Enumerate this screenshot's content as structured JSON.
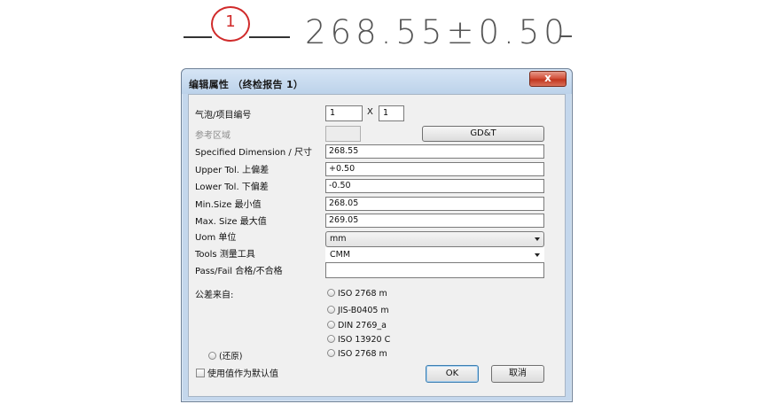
{
  "drawing": {
    "balloon_number": "1",
    "dimension_text": "268.55±0.50"
  },
  "dialog": {
    "title": "编辑属性 （终检报告 1）",
    "close_glyph": "x",
    "bubble": {
      "label": "气泡/项目编号",
      "value1": "1",
      "separator": "X",
      "value2": "1"
    },
    "reference_area": {
      "label": "参考区域"
    },
    "gdt_button": "GD&T",
    "fields": [
      {
        "key": "specified_dimension",
        "label": "Specified Dimension / 尺寸",
        "value": "268.55"
      },
      {
        "key": "upper_tol",
        "label": "Upper Tol. 上偏差",
        "value": "+0.50"
      },
      {
        "key": "lower_tol",
        "label": "Lower Tol. 下偏差",
        "value": "-0.50"
      },
      {
        "key": "min_size",
        "label": "Min.Size 最小值",
        "value": "268.05"
      },
      {
        "key": "max_size",
        "label": "Max. Size 最大值",
        "value": "269.05"
      }
    ],
    "uom": {
      "label": "Uom 单位",
      "value": "mm"
    },
    "tools": {
      "label": "Tools 测量工具",
      "value": "CMM"
    },
    "pass_fail": {
      "label": "Pass/Fail 合格/不合格",
      "value": ""
    },
    "tolerance_from": {
      "label": "公差来自:",
      "options": [
        "ISO 2768 m",
        "JIS-B0405 m",
        "DIN 2769_a",
        "ISO 13920 C",
        "ISO 2768 m"
      ]
    },
    "restore_label": "(还原)",
    "use_as_default_label": "使用值作为默认值",
    "ok_button": "OK",
    "cancel_button": "取消"
  }
}
